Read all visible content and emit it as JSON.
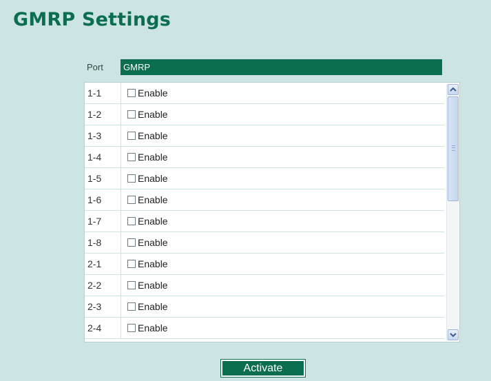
{
  "page": {
    "title": "GMRP Settings"
  },
  "table": {
    "headers": {
      "port": "Port",
      "gmrp": "GMRP"
    },
    "rows": [
      {
        "port": "1-1",
        "label": "Enable",
        "checked": false
      },
      {
        "port": "1-2",
        "label": "Enable",
        "checked": false
      },
      {
        "port": "1-3",
        "label": "Enable",
        "checked": false
      },
      {
        "port": "1-4",
        "label": "Enable",
        "checked": false
      },
      {
        "port": "1-5",
        "label": "Enable",
        "checked": false
      },
      {
        "port": "1-6",
        "label": "Enable",
        "checked": false
      },
      {
        "port": "1-7",
        "label": "Enable",
        "checked": false
      },
      {
        "port": "1-8",
        "label": "Enable",
        "checked": false
      },
      {
        "port": "2-1",
        "label": "Enable",
        "checked": false
      },
      {
        "port": "2-2",
        "label": "Enable",
        "checked": false
      },
      {
        "port": "2-3",
        "label": "Enable",
        "checked": false
      },
      {
        "port": "2-4",
        "label": "Enable",
        "checked": false
      }
    ]
  },
  "actions": {
    "activate_label": "Activate"
  },
  "colors": {
    "accent": "#0b6e51",
    "background": "#cde4e4"
  },
  "icons": {
    "scroll_up": "chevron-up-icon",
    "scroll_down": "chevron-down-icon"
  }
}
